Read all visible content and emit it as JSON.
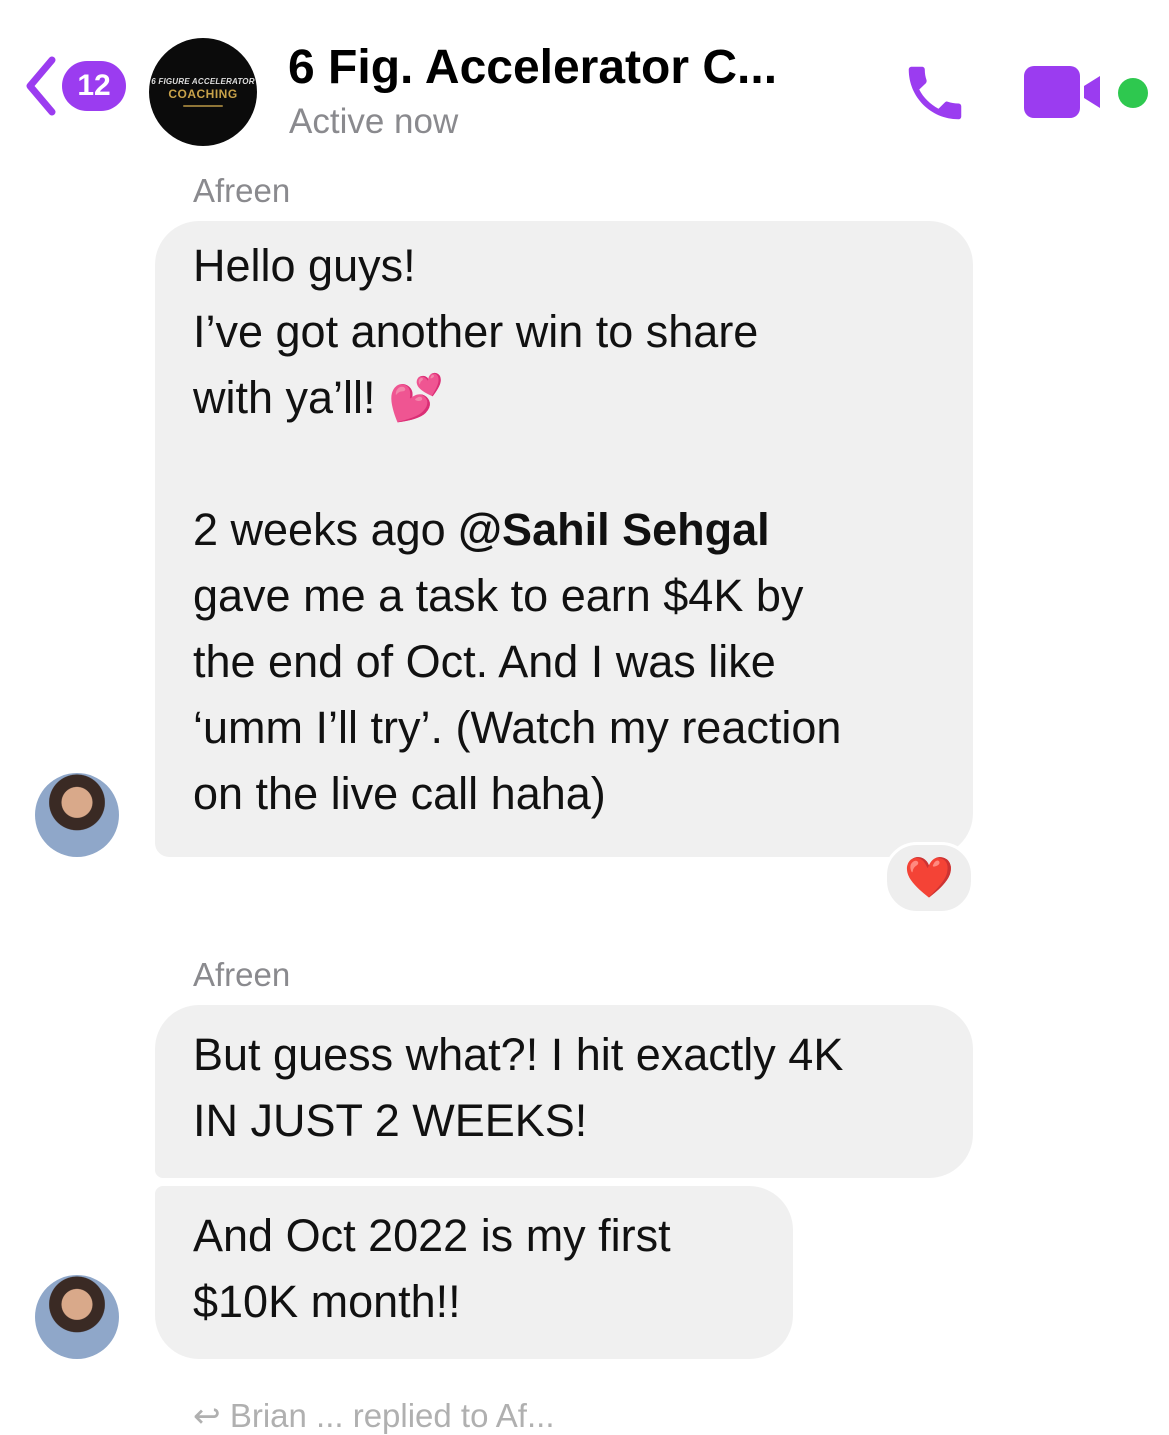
{
  "header": {
    "unread_count": "12",
    "group_name": "6 Fig. Accelerator C...",
    "status": "Active now",
    "avatar_text_line1": "6 FIGURE ACCELERATOR",
    "avatar_text_line2": "COACHING"
  },
  "colors": {
    "accent": "#9b3cf0",
    "active": "#2ec84f",
    "bubble": "#f0f0f0"
  },
  "messages": [
    {
      "sender": "Afreen",
      "lines": [
        "Hello guys!",
        "I’ve got another win to share",
        "with ya’ll! 💕",
        "",
        "2 weeks ago ",
        "@Sahil Sehgal",
        "gave me a task to earn $4K by",
        "the end of Oct. And I was like",
        "‘umm I’ll try’. (Watch my reaction",
        "on the live call haha)"
      ],
      "reaction": "❤️"
    },
    {
      "sender": "Afreen",
      "lines": [
        "But guess what?! I hit exactly 4K",
        "IN JUST 2 WEEKS!"
      ]
    },
    {
      "lines": [
        "And Oct 2022 is my first",
        "$10K month!!"
      ]
    }
  ],
  "footer": {
    "cut_text": "↩ Brian ... replied to Af..."
  }
}
